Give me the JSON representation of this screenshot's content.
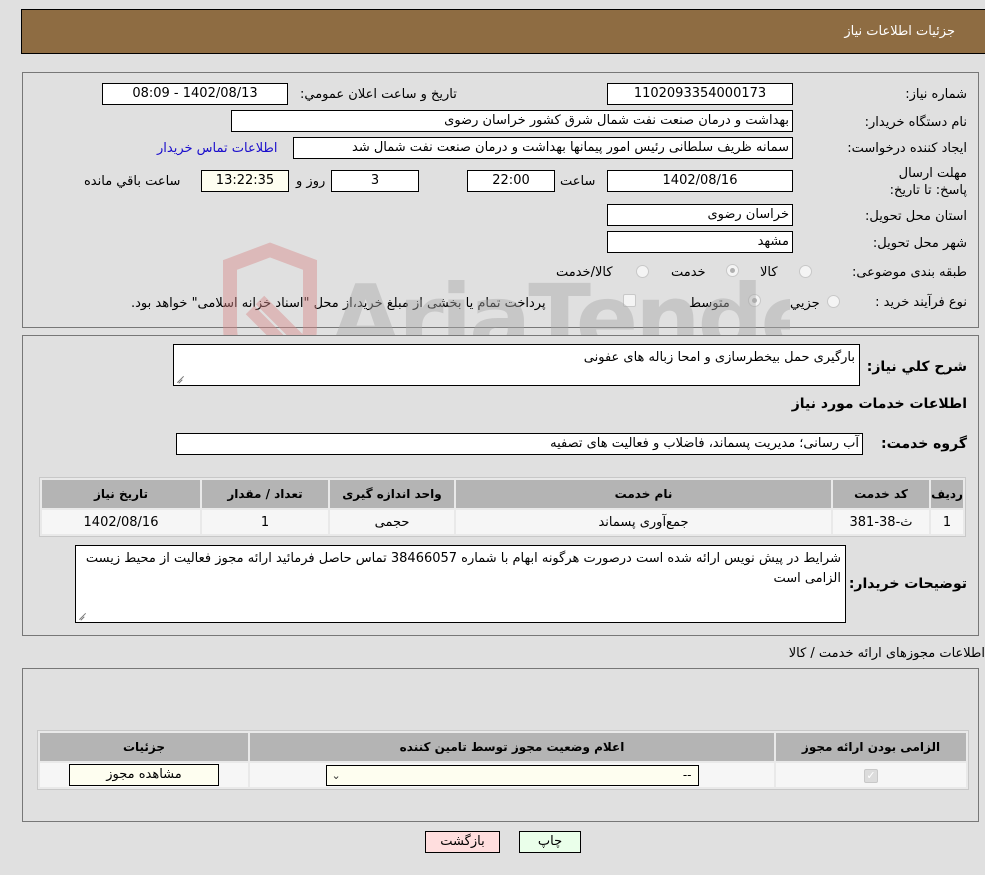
{
  "header": {
    "title": "جزئیات اطلاعات نیاز"
  },
  "info": {
    "need_number_label": "شماره نیاز:",
    "need_number": "1102093354000173",
    "announce_label": "تاریخ و ساعت اعلان عمومي:",
    "announce_value": "1402/08/13 - 08:09",
    "buyer_org_label": "نام دستگاه خریدار:",
    "buyer_org": "بهداشت و درمان صنعت نفت شمال شرق کشور   خراسان رضوی",
    "requester_label": "ایجاد کننده درخواست:",
    "requester": "سمانه ظریف سلطانی رئیس امور پیمانها بهداشت و درمان صنعت نفت شمال شد",
    "buyer_contact_link": "اطلاعات تماس خریدار",
    "deadline_label": "مهلت ارسال پاسخ: تا تاریخ:",
    "deadline_date": "1402/08/16",
    "time_label": "ساعت",
    "deadline_time": "22:00",
    "days_value": "3",
    "days_label": "روز و",
    "remaining_time": "13:22:35",
    "remaining_label": "ساعت باقي مانده",
    "province_label": "استان محل تحویل:",
    "province": "خراسان رضوی",
    "city_label": "شهر محل تحویل:",
    "city": "مشهد",
    "category_label": "طبقه بندی موضوعی:",
    "category_options": [
      {
        "label": "کالا",
        "checked": false
      },
      {
        "label": "خدمت",
        "checked": true
      },
      {
        "label": "کالا/خدمت",
        "checked": false
      }
    ],
    "purchase_type_label": "نوع فرآیند خرید :",
    "purchase_type_options": [
      {
        "label": "جزيي",
        "checked": false
      },
      {
        "label": "متوسط",
        "checked": true
      }
    ],
    "treasury_checkbox_label": "پرداخت تمام یا بخشی از مبلغ خرید،از محل \"اسناد خزانه اسلامی\" خواهد بود.",
    "treasury_checked": false
  },
  "watermark": {
    "text": "AriaTender.neT"
  },
  "description": {
    "summary_label": "شرح کلي نیاز:",
    "summary": "بارگیری حمل بیخطرسازی و امحا زباله های عفونی",
    "services_heading": "اطلاعات خدمات مورد نیاز",
    "service_group_label": "گروه خدمت:",
    "service_group": "آب رسانی؛ مدیریت پسماند، فاضلاب و فعالیت های تصفیه",
    "table": {
      "headers": [
        "ردیف",
        "کد خدمت",
        "نام خدمت",
        "واحد اندازه گیری",
        "تعداد / مقدار",
        "تاریخ نیاز"
      ],
      "rows": [
        [
          "1",
          "ث-38-381",
          "جمع‌آوری پسماند",
          "حجمی",
          "1",
          "1402/08/16"
        ]
      ]
    },
    "buyer_notes_label": "توضیحات خریدار:",
    "buyer_notes": "شرایط در پیش نویس ارائه شده است درصورت هرگونه ابهام با شماره 38466057 تماس حاصل فرمائید ارائه مجوز فعالیت از محیط زیست الزامی است"
  },
  "license": {
    "section_title": "اطلاعات مجوزهای ارائه خدمت / کالا",
    "headers": [
      "الزامی بودن ارائه مجوز",
      "اعلام وضعیت مجوز توسط تامین کننده",
      "جزئیات"
    ],
    "row": {
      "required_checked": true,
      "status_select": "--",
      "view_button": "مشاهده مجوز"
    }
  },
  "actions": {
    "back": "بازگشت",
    "print": "چاپ"
  }
}
